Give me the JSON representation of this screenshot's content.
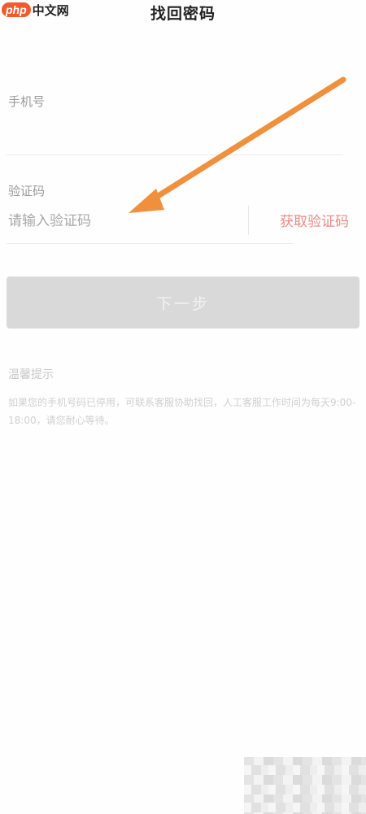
{
  "watermark": {
    "logo": "php",
    "text": "中文网"
  },
  "header": {
    "title": "找回密码"
  },
  "form": {
    "phone_label": "手机号",
    "code_label": "验证码",
    "code_placeholder": "请输入验证码",
    "get_code_label": "获取验证码"
  },
  "next_button": {
    "label": "下一步"
  },
  "tips": {
    "title": "温馨提示",
    "text": "如果您的手机号码已停用，可联系客服协助找回，人工客服工作时间为每天9:00-18:00，请您耐心等待。"
  },
  "colors": {
    "accent": "#e98b87",
    "annotation_arrow": "#f0903c",
    "button_disabled": "#d9d9d9"
  }
}
